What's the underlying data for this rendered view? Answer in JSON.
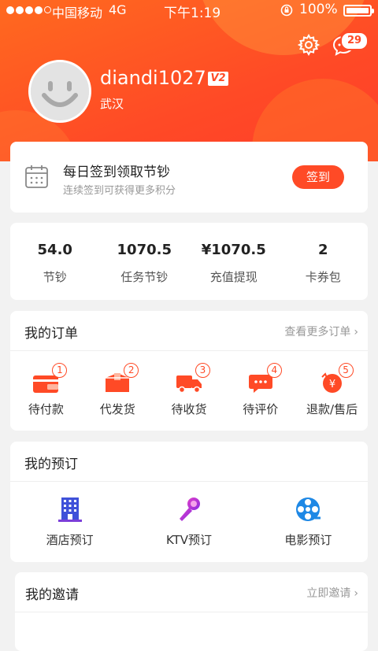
{
  "status_bar": {
    "carrier": "中国移动",
    "network": "4G",
    "time": "下午1:19",
    "battery": "100%"
  },
  "header": {
    "message_count": "29",
    "username": "diandi1027",
    "vip_level": "V2",
    "city": "武汉"
  },
  "checkin": {
    "title": "每日签到领取节钞",
    "subtitle": "连续签到可获得更多积分",
    "button": "签到"
  },
  "stats": [
    {
      "value": "54.0",
      "label": "节钞"
    },
    {
      "value": "1070.5",
      "label": "任务节钞"
    },
    {
      "value": "¥1070.5",
      "label": "充值提现"
    },
    {
      "value": "2",
      "label": "卡券包"
    }
  ],
  "orders": {
    "title": "我的订单",
    "more": "查看更多订单",
    "items": [
      {
        "label": "待付款",
        "count": "1",
        "icon": "wallet-icon"
      },
      {
        "label": "代发货",
        "count": "2",
        "icon": "box-icon"
      },
      {
        "label": "待收货",
        "count": "3",
        "icon": "truck-icon"
      },
      {
        "label": "待评价",
        "count": "4",
        "icon": "comment-icon"
      },
      {
        "label": "退款/售后",
        "count": "5",
        "icon": "refund-icon"
      }
    ]
  },
  "booking": {
    "title": "我的预订",
    "items": [
      {
        "label": "酒店预订",
        "icon": "hotel-icon"
      },
      {
        "label": "KTV预订",
        "icon": "microphone-icon"
      },
      {
        "label": "电影预订",
        "icon": "film-reel-icon"
      }
    ]
  },
  "invite": {
    "title": "我的邀请",
    "more": "立即邀请"
  },
  "colors": {
    "brand": "#ff4a26",
    "header_start": "#ff6a1f"
  }
}
